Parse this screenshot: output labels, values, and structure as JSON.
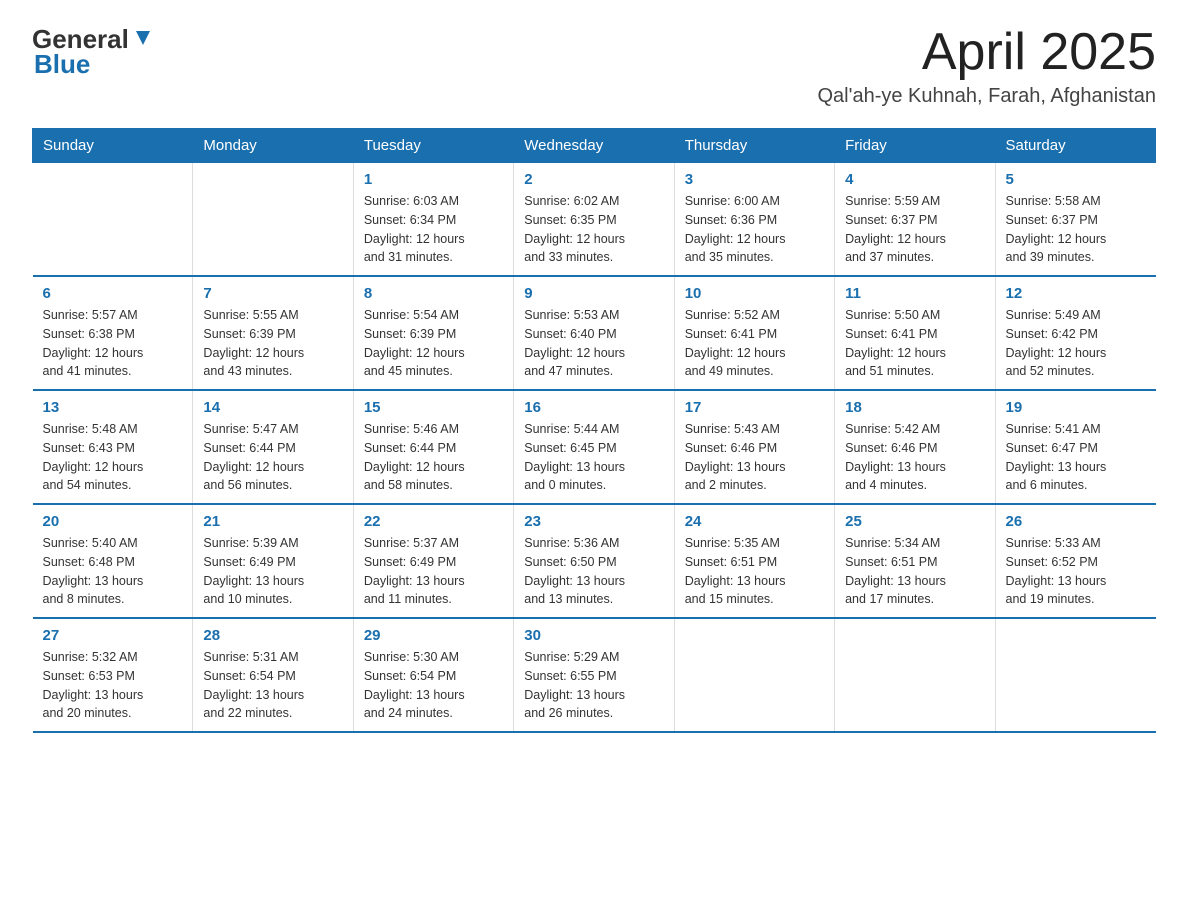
{
  "logo": {
    "general": "General",
    "blue": "Blue"
  },
  "header": {
    "month": "April 2025",
    "location": "Qal'ah-ye Kuhnah, Farah, Afghanistan"
  },
  "days_of_week": [
    "Sunday",
    "Monday",
    "Tuesday",
    "Wednesday",
    "Thursday",
    "Friday",
    "Saturday"
  ],
  "weeks": [
    [
      {
        "day": "",
        "info": ""
      },
      {
        "day": "",
        "info": ""
      },
      {
        "day": "1",
        "info": "Sunrise: 6:03 AM\nSunset: 6:34 PM\nDaylight: 12 hours\nand 31 minutes."
      },
      {
        "day": "2",
        "info": "Sunrise: 6:02 AM\nSunset: 6:35 PM\nDaylight: 12 hours\nand 33 minutes."
      },
      {
        "day": "3",
        "info": "Sunrise: 6:00 AM\nSunset: 6:36 PM\nDaylight: 12 hours\nand 35 minutes."
      },
      {
        "day": "4",
        "info": "Sunrise: 5:59 AM\nSunset: 6:37 PM\nDaylight: 12 hours\nand 37 minutes."
      },
      {
        "day": "5",
        "info": "Sunrise: 5:58 AM\nSunset: 6:37 PM\nDaylight: 12 hours\nand 39 minutes."
      }
    ],
    [
      {
        "day": "6",
        "info": "Sunrise: 5:57 AM\nSunset: 6:38 PM\nDaylight: 12 hours\nand 41 minutes."
      },
      {
        "day": "7",
        "info": "Sunrise: 5:55 AM\nSunset: 6:39 PM\nDaylight: 12 hours\nand 43 minutes."
      },
      {
        "day": "8",
        "info": "Sunrise: 5:54 AM\nSunset: 6:39 PM\nDaylight: 12 hours\nand 45 minutes."
      },
      {
        "day": "9",
        "info": "Sunrise: 5:53 AM\nSunset: 6:40 PM\nDaylight: 12 hours\nand 47 minutes."
      },
      {
        "day": "10",
        "info": "Sunrise: 5:52 AM\nSunset: 6:41 PM\nDaylight: 12 hours\nand 49 minutes."
      },
      {
        "day": "11",
        "info": "Sunrise: 5:50 AM\nSunset: 6:41 PM\nDaylight: 12 hours\nand 51 minutes."
      },
      {
        "day": "12",
        "info": "Sunrise: 5:49 AM\nSunset: 6:42 PM\nDaylight: 12 hours\nand 52 minutes."
      }
    ],
    [
      {
        "day": "13",
        "info": "Sunrise: 5:48 AM\nSunset: 6:43 PM\nDaylight: 12 hours\nand 54 minutes."
      },
      {
        "day": "14",
        "info": "Sunrise: 5:47 AM\nSunset: 6:44 PM\nDaylight: 12 hours\nand 56 minutes."
      },
      {
        "day": "15",
        "info": "Sunrise: 5:46 AM\nSunset: 6:44 PM\nDaylight: 12 hours\nand 58 minutes."
      },
      {
        "day": "16",
        "info": "Sunrise: 5:44 AM\nSunset: 6:45 PM\nDaylight: 13 hours\nand 0 minutes."
      },
      {
        "day": "17",
        "info": "Sunrise: 5:43 AM\nSunset: 6:46 PM\nDaylight: 13 hours\nand 2 minutes."
      },
      {
        "day": "18",
        "info": "Sunrise: 5:42 AM\nSunset: 6:46 PM\nDaylight: 13 hours\nand 4 minutes."
      },
      {
        "day": "19",
        "info": "Sunrise: 5:41 AM\nSunset: 6:47 PM\nDaylight: 13 hours\nand 6 minutes."
      }
    ],
    [
      {
        "day": "20",
        "info": "Sunrise: 5:40 AM\nSunset: 6:48 PM\nDaylight: 13 hours\nand 8 minutes."
      },
      {
        "day": "21",
        "info": "Sunrise: 5:39 AM\nSunset: 6:49 PM\nDaylight: 13 hours\nand 10 minutes."
      },
      {
        "day": "22",
        "info": "Sunrise: 5:37 AM\nSunset: 6:49 PM\nDaylight: 13 hours\nand 11 minutes."
      },
      {
        "day": "23",
        "info": "Sunrise: 5:36 AM\nSunset: 6:50 PM\nDaylight: 13 hours\nand 13 minutes."
      },
      {
        "day": "24",
        "info": "Sunrise: 5:35 AM\nSunset: 6:51 PM\nDaylight: 13 hours\nand 15 minutes."
      },
      {
        "day": "25",
        "info": "Sunrise: 5:34 AM\nSunset: 6:51 PM\nDaylight: 13 hours\nand 17 minutes."
      },
      {
        "day": "26",
        "info": "Sunrise: 5:33 AM\nSunset: 6:52 PM\nDaylight: 13 hours\nand 19 minutes."
      }
    ],
    [
      {
        "day": "27",
        "info": "Sunrise: 5:32 AM\nSunset: 6:53 PM\nDaylight: 13 hours\nand 20 minutes."
      },
      {
        "day": "28",
        "info": "Sunrise: 5:31 AM\nSunset: 6:54 PM\nDaylight: 13 hours\nand 22 minutes."
      },
      {
        "day": "29",
        "info": "Sunrise: 5:30 AM\nSunset: 6:54 PM\nDaylight: 13 hours\nand 24 minutes."
      },
      {
        "day": "30",
        "info": "Sunrise: 5:29 AM\nSunset: 6:55 PM\nDaylight: 13 hours\nand 26 minutes."
      },
      {
        "day": "",
        "info": ""
      },
      {
        "day": "",
        "info": ""
      },
      {
        "day": "",
        "info": ""
      }
    ]
  ]
}
